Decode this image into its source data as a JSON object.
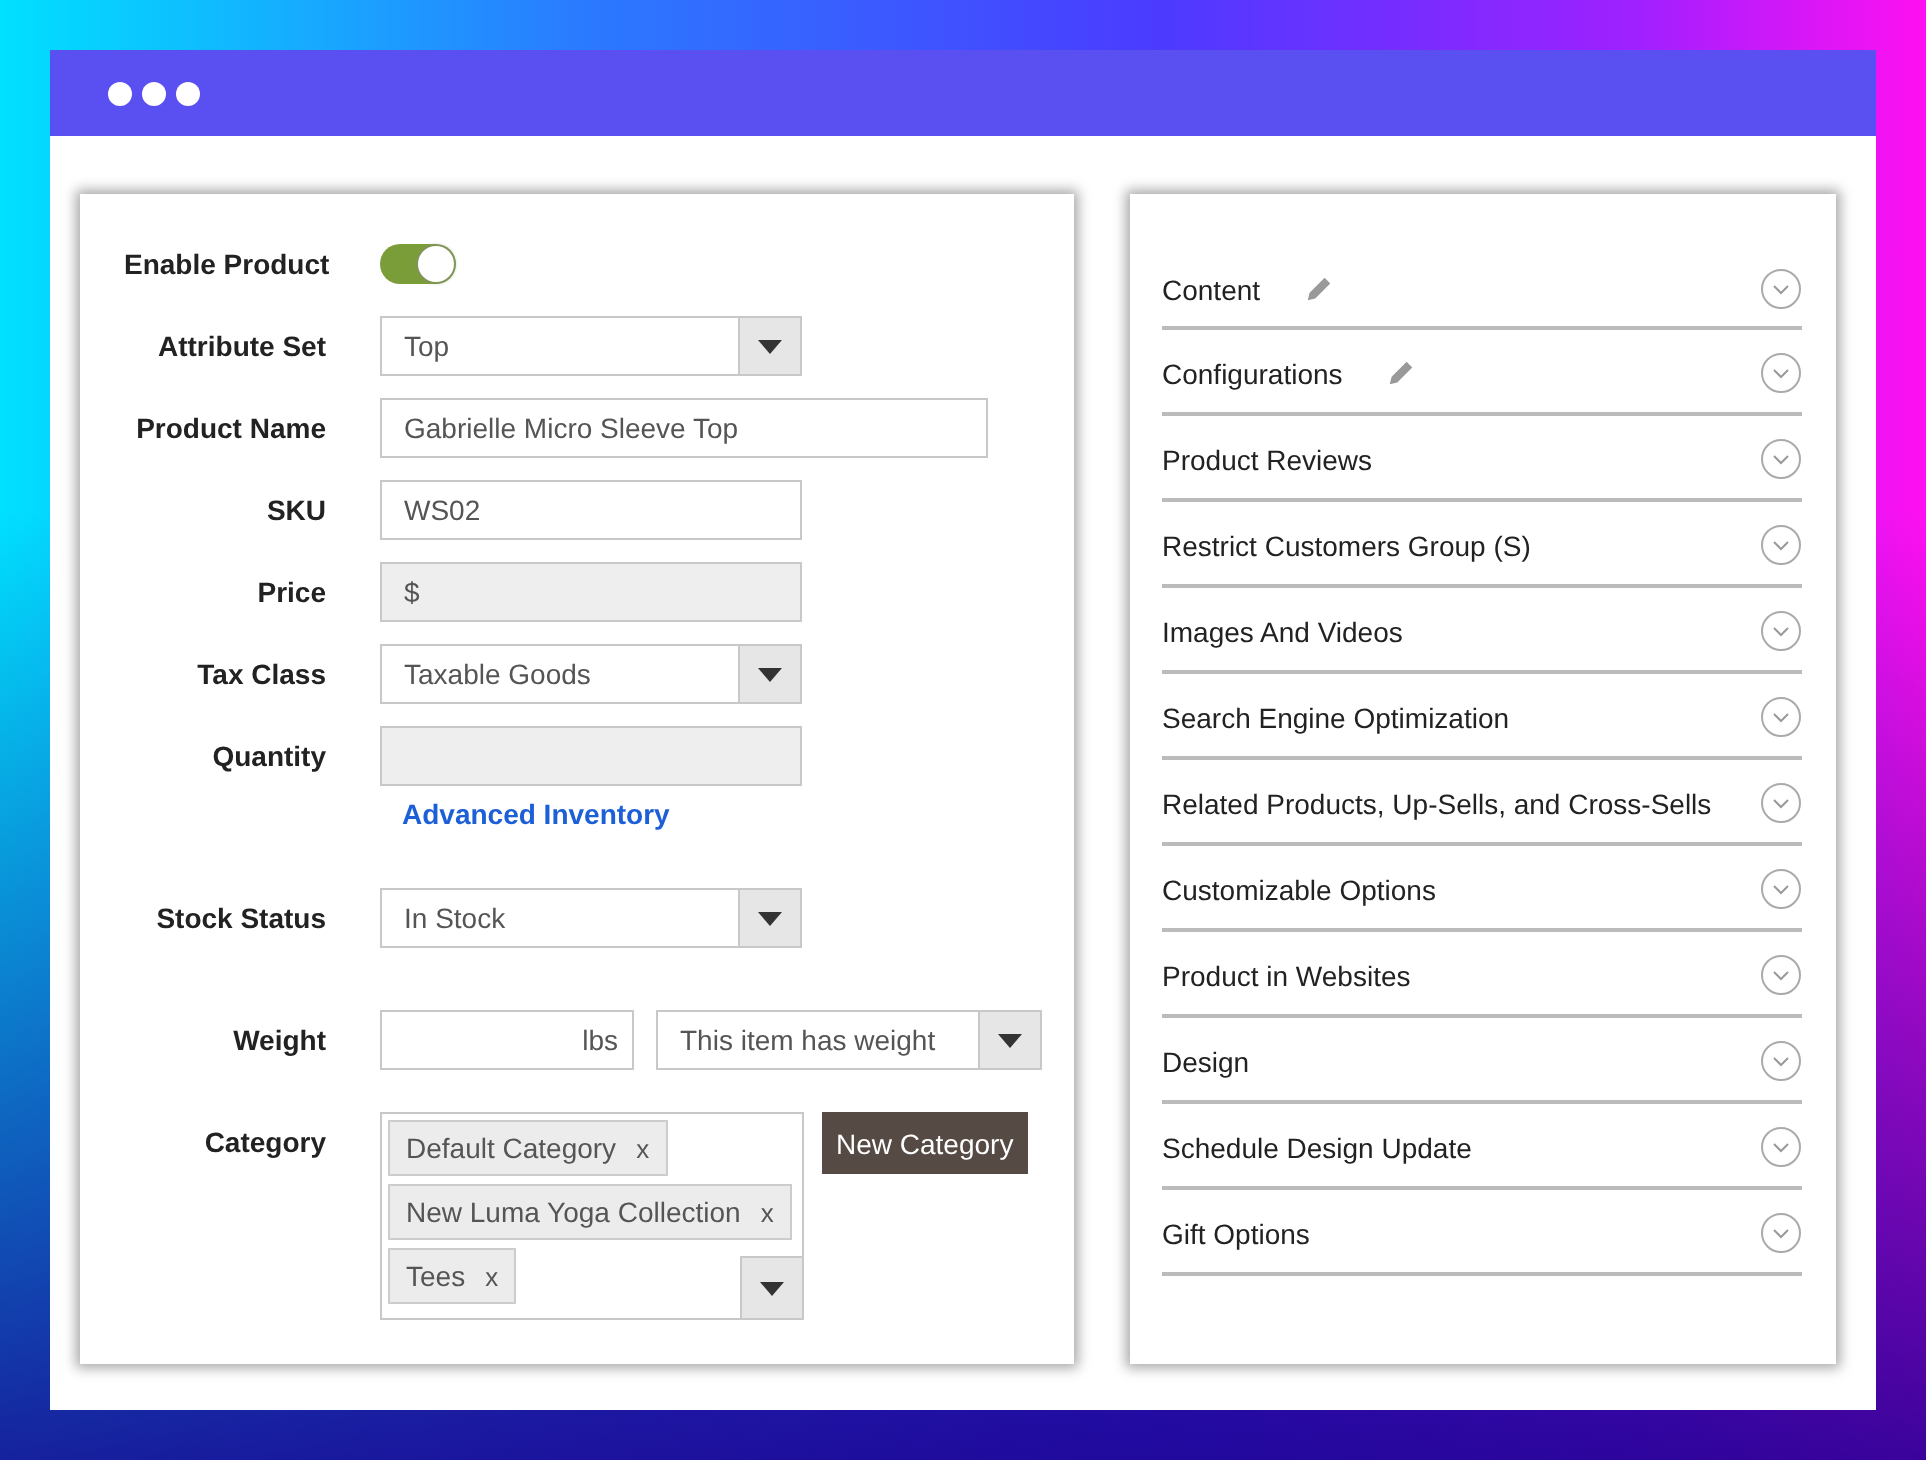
{
  "product_form": {
    "fields": [
      {
        "label": "Enable Product",
        "kind": "toggle",
        "on": true
      },
      {
        "label": "Attribute Set",
        "kind": "select",
        "value": "Top"
      },
      {
        "label": "Product Name",
        "kind": "text",
        "value": "Gabrielle Micro Sleeve Top"
      },
      {
        "label": "SKU",
        "kind": "text",
        "value": "WS02"
      },
      {
        "label": "Price",
        "kind": "disabled",
        "value": "$"
      },
      {
        "label": "Tax Class",
        "kind": "select",
        "value": "Taxable Goods"
      },
      {
        "label": "Quantity",
        "kind": "disabled",
        "link": "Advanced Inventory"
      },
      {
        "label": "Stock Status",
        "kind": "select",
        "value": "In Stock"
      },
      {
        "label": "Weight",
        "kind": "weight",
        "unit": "lbs",
        "value": "This item has weight"
      },
      {
        "label": "Category",
        "kind": "category",
        "tags": [
          {
            "label": "Default Category",
            "remove": "x"
          },
          {
            "label": "New Luma Yoga Collection",
            "remove": "x"
          },
          {
            "label": "Tees",
            "remove": "x"
          }
        ],
        "button": "New Category"
      }
    ]
  },
  "sections": [
    {
      "title": "Content",
      "editable": true
    },
    {
      "title": "Configurations",
      "editable": true
    },
    {
      "title": "Product Reviews",
      "editable": false
    },
    {
      "title": "Restrict Customers Group (S)",
      "editable": false
    },
    {
      "title": "Images And Videos",
      "editable": false
    },
    {
      "title": "Search Engine Optimization",
      "editable": false
    },
    {
      "title": "Related Products, Up-Sells, and Cross-Sells",
      "editable": false
    },
    {
      "title": "Customizable Options",
      "editable": false
    },
    {
      "title": "Product in Websites",
      "editable": false
    },
    {
      "title": "Design",
      "editable": false
    },
    {
      "title": "Schedule Design Update",
      "editable": false
    },
    {
      "title": "Gift Options",
      "editable": false
    }
  ]
}
